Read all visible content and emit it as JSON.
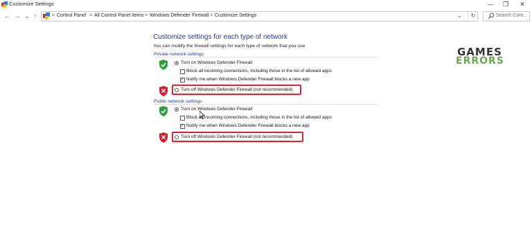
{
  "window": {
    "title": "Customize Settings",
    "minimize": "—",
    "maximize": "❐",
    "close": "✕"
  },
  "nav": {
    "back": "←",
    "forward": "→",
    "recent": "⌄",
    "up": "↑"
  },
  "address": {
    "crumbs": [
      "Control Panel",
      "All Control Panel Items",
      "Windows Defender Firewall",
      "Customize Settings"
    ],
    "separator": ">",
    "dropdown": "⌄",
    "refresh": "↻"
  },
  "search": {
    "placeholder": "Search Cont..."
  },
  "content": {
    "heading": "Customize settings for each type of network",
    "intro": "You can modify the firewall settings for each type of network that you use.",
    "private": {
      "title": "Private network settings",
      "turn_on": "Turn on Windows Defender Firewall",
      "block_all": "Block all incoming connections, including those in the list of allowed apps",
      "notify": "Notify me when Windows Defender Firewall blocks a new app",
      "turn_off": "Turn off Windows Defender Firewall (not recommended)",
      "turn_on_selected": true,
      "block_all_checked": false,
      "notify_checked": true
    },
    "public": {
      "title": "Public network settings",
      "turn_on": "Turn on Windows Defender Firewall",
      "block_all": "Block all incoming connections, including those in the list of allowed apps",
      "notify": "Notify me when Windows Defender Firewall blocks a new app",
      "turn_off": "Turn off Windows Defender Firewall (not recommended)",
      "turn_on_selected": true,
      "block_all_checked": false,
      "notify_checked": true
    }
  },
  "logo": {
    "line1": "GAMES",
    "line2": "ERRORS"
  },
  "colors": {
    "heading": "#1c3a9e",
    "highlight": "#e0212f",
    "shield_green": "#2e9e3a",
    "shield_red": "#d1202e",
    "logo_green": "#6aa84f"
  },
  "icons": {
    "app": "control-panel-icon",
    "search": "search-icon",
    "shield_on": "green-shield-check-icon",
    "shield_off": "red-shield-x-icon"
  }
}
